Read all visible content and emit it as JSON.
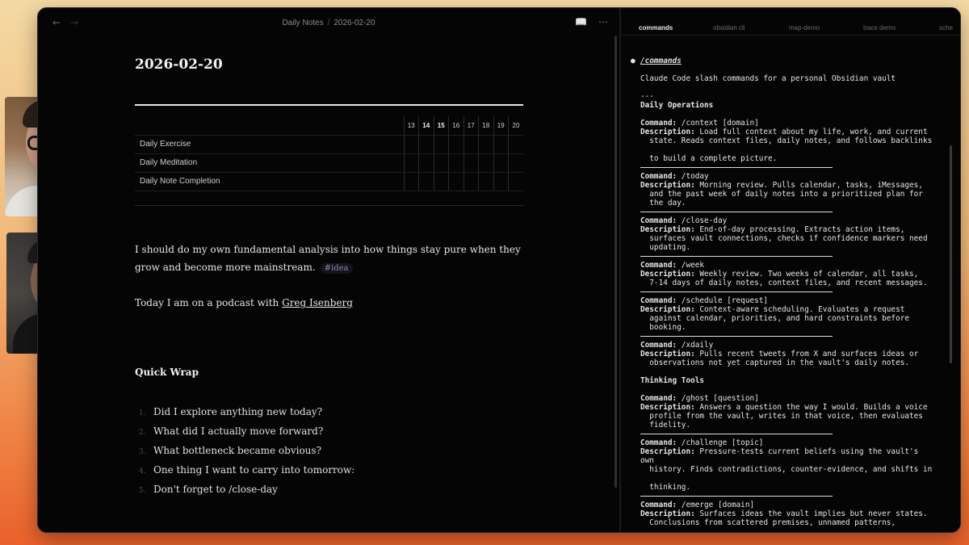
{
  "topbar": {
    "back": "←",
    "forward": "→",
    "crumb_folder": "Daily Notes",
    "crumb_sep": "/",
    "crumb_file": "2026-02-20",
    "book_icon": "📖",
    "more_icon": "⋯"
  },
  "note": {
    "title": "2026-02-20",
    "tracker": {
      "days": [
        "13",
        "14",
        "15",
        "16",
        "17",
        "18",
        "19",
        "20"
      ],
      "habits": [
        "Daily Exercise",
        "Daily Meditation",
        "Daily Note Completion"
      ]
    },
    "para1": "I should do my own fundamental analysis into how things stay pure when they grow and become more mainstream.",
    "para1_tag": "#idea",
    "para2_prefix": "Today I am on a podcast with ",
    "para2_link": "Greg Isenberg",
    "section": "Quick Wrap",
    "questions": [
      "Did I explore anything new today?",
      "What did I actually move forward?",
      "What bottleneck became obvious?",
      "One thing I want to carry into tomorrow:",
      "Don't forget to /close-day"
    ],
    "question_nums": [
      "1.",
      "2.",
      "3.",
      "4.",
      "5."
    ]
  },
  "tabs": [
    "commands",
    "obsidian cli",
    "map-demo",
    "trace demo",
    "sche"
  ],
  "doc": {
    "heading": "/commands",
    "subtitle": "Claude Code slash commands for a personal Obsidian vault",
    "hr": "---",
    "section1": "Daily Operations",
    "section2": "Thinking Tools",
    "cmd_label": "Command:",
    "desc_label": "Description:",
    "commands": [
      {
        "cmd": " /context [domain]",
        "desc": [
          " Load full context about my life, work, and current",
          "  state. Reads context files, daily notes, and follows backlinks",
          "",
          "  to build a complete picture."
        ]
      },
      {
        "cmd": " /today",
        "desc": [
          " Morning review. Pulls calendar, tasks, iMessages,",
          "  and the past week of daily notes into a prioritized plan for",
          "  the day."
        ]
      },
      {
        "cmd": " /close-day",
        "desc": [
          " End-of-day processing. Extracts action items,",
          "  surfaces vault connections, checks if confidence markers need",
          "  updating."
        ]
      },
      {
        "cmd": " /week",
        "desc": [
          " Weekly review. Two weeks of calendar, all tasks,",
          "  7-14 days of daily notes, context files, and recent messages."
        ]
      },
      {
        "cmd": " /schedule [request]",
        "desc": [
          " Context-aware scheduling. Evaluates a request",
          "  against calendar, priorities, and hard constraints before",
          "  booking."
        ]
      },
      {
        "cmd": " /xdaily",
        "desc": [
          " Pulls recent tweets from X and surfaces ideas or",
          "  observations not yet captured in the vault's daily notes."
        ]
      },
      {
        "cmd": " /ghost [question]",
        "desc": [
          " Answers a question the way I would. Builds a voice",
          "  profile from the vault, writes in that voice, then evaluates",
          "  fidelity."
        ]
      },
      {
        "cmd": " /challenge [topic]",
        "desc": [
          " Pressure-tests current beliefs using the vault's",
          "own",
          "  history. Finds contradictions, counter-evidence, and shifts in",
          "",
          "  thinking."
        ]
      },
      {
        "cmd": " /emerge [domain]",
        "desc": [
          " Surfaces ideas the vault implies but never states.",
          "  Conclusions from scattered premises, unnamed patterns,"
        ]
      }
    ]
  }
}
